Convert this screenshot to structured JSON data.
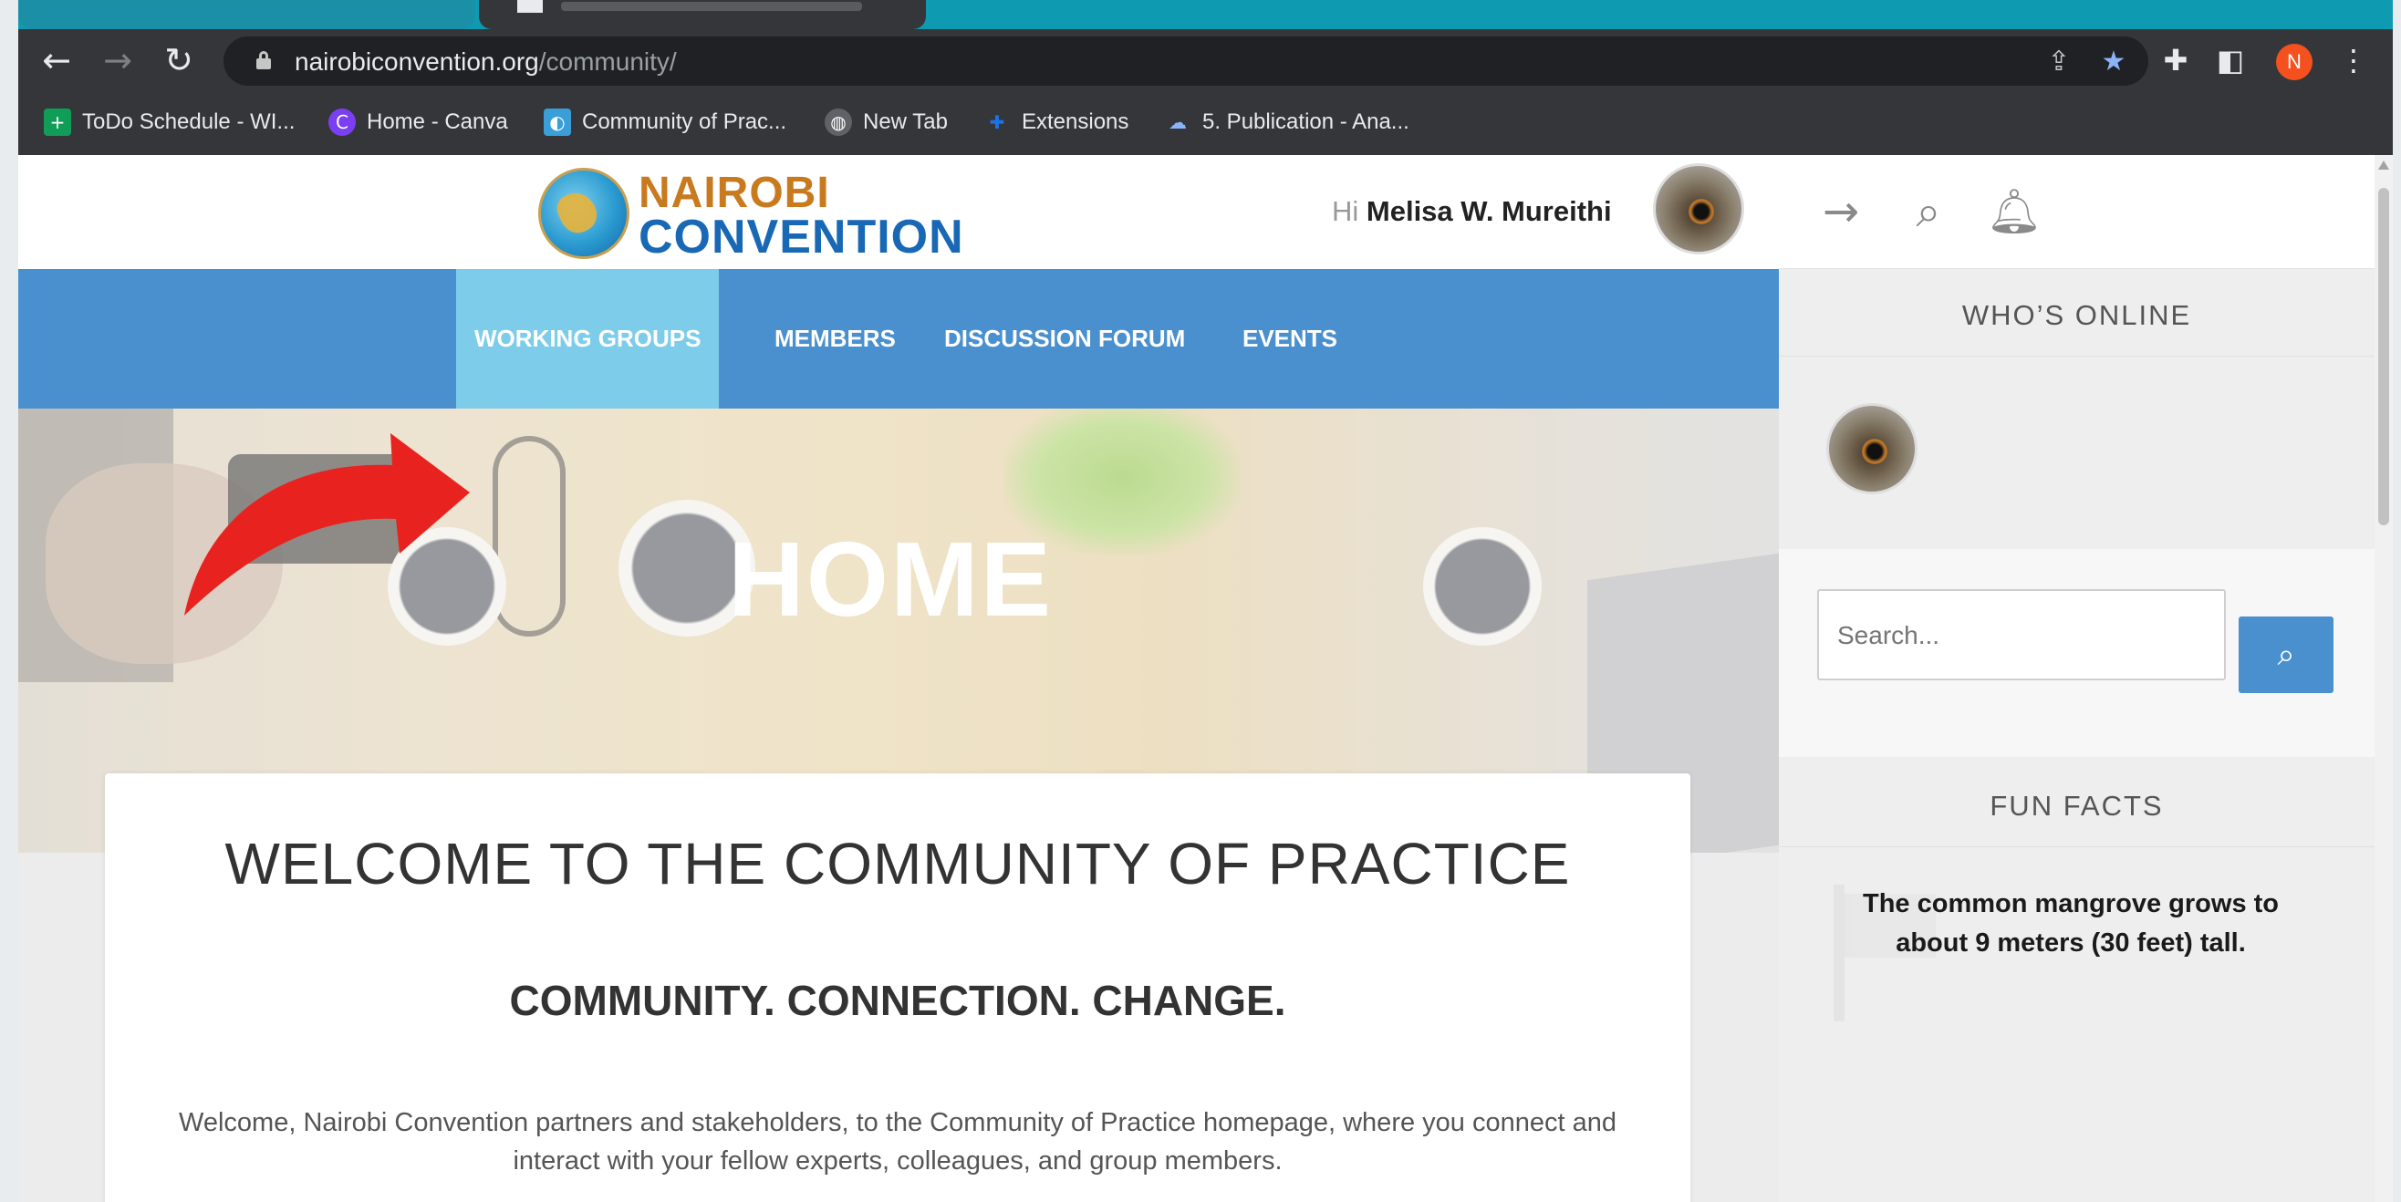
{
  "browser": {
    "url_domain": "nairobiconvention.org",
    "url_path": "/community/",
    "profile_initial": "N",
    "bookmarks": [
      {
        "label": "ToDo Schedule - WI...",
        "icon": "google-sheets-icon",
        "color": "#0f9d58",
        "glyph": "+"
      },
      {
        "label": "Home - Canva",
        "icon": "canva-icon",
        "color": "#7b3ff2",
        "glyph": "C"
      },
      {
        "label": "Community of Prac...",
        "icon": "nairobi-convention-favicon",
        "color": "#3a9fd8",
        "glyph": "◐"
      },
      {
        "label": "New Tab",
        "icon": "globe-icon",
        "color": "#5f6368",
        "glyph": "◍"
      },
      {
        "label": "Extensions",
        "icon": "puzzle-icon",
        "color": "#1a73e8",
        "glyph": "✚"
      },
      {
        "label": "5. Publication - Ana...",
        "icon": "cloud-icon",
        "color": "#8ab4f8",
        "glyph": "☁"
      }
    ]
  },
  "site": {
    "logo_line1": "NAIROBI",
    "logo_line2": "CONVENTION",
    "greeting_prefix": "Hi ",
    "user_name": "Melisa W. Mureithi",
    "nav": [
      "WORKING GROUPS",
      "MEMBERS",
      "DISCUSSION FORUM",
      "EVENTS"
    ],
    "hero_title": "HOME",
    "welcome_heading": "WELCOME TO THE COMMUNITY OF PRACTICE",
    "tagline": "COMMUNITY. CONNECTION. CHANGE.",
    "intro": "Welcome, Nairobi Convention partners and stakeholders, to the Community of Practice homepage, where you connect and interact with your fellow experts, colleagues, and group members."
  },
  "sidebar": {
    "whos_online_title": "WHO’S ONLINE",
    "search_placeholder": "Search...",
    "fun_facts_title": "FUN FACTS",
    "fun_fact": "The common mangrove grows to about 9 meters (30 feet) tall."
  },
  "colors": {
    "nav_bg": "#4a90cf",
    "nav_active": "#7dcdea",
    "logo_orange": "#c97a1e",
    "logo_blue": "#1868b5",
    "annotation_arrow": "#e8231f"
  }
}
